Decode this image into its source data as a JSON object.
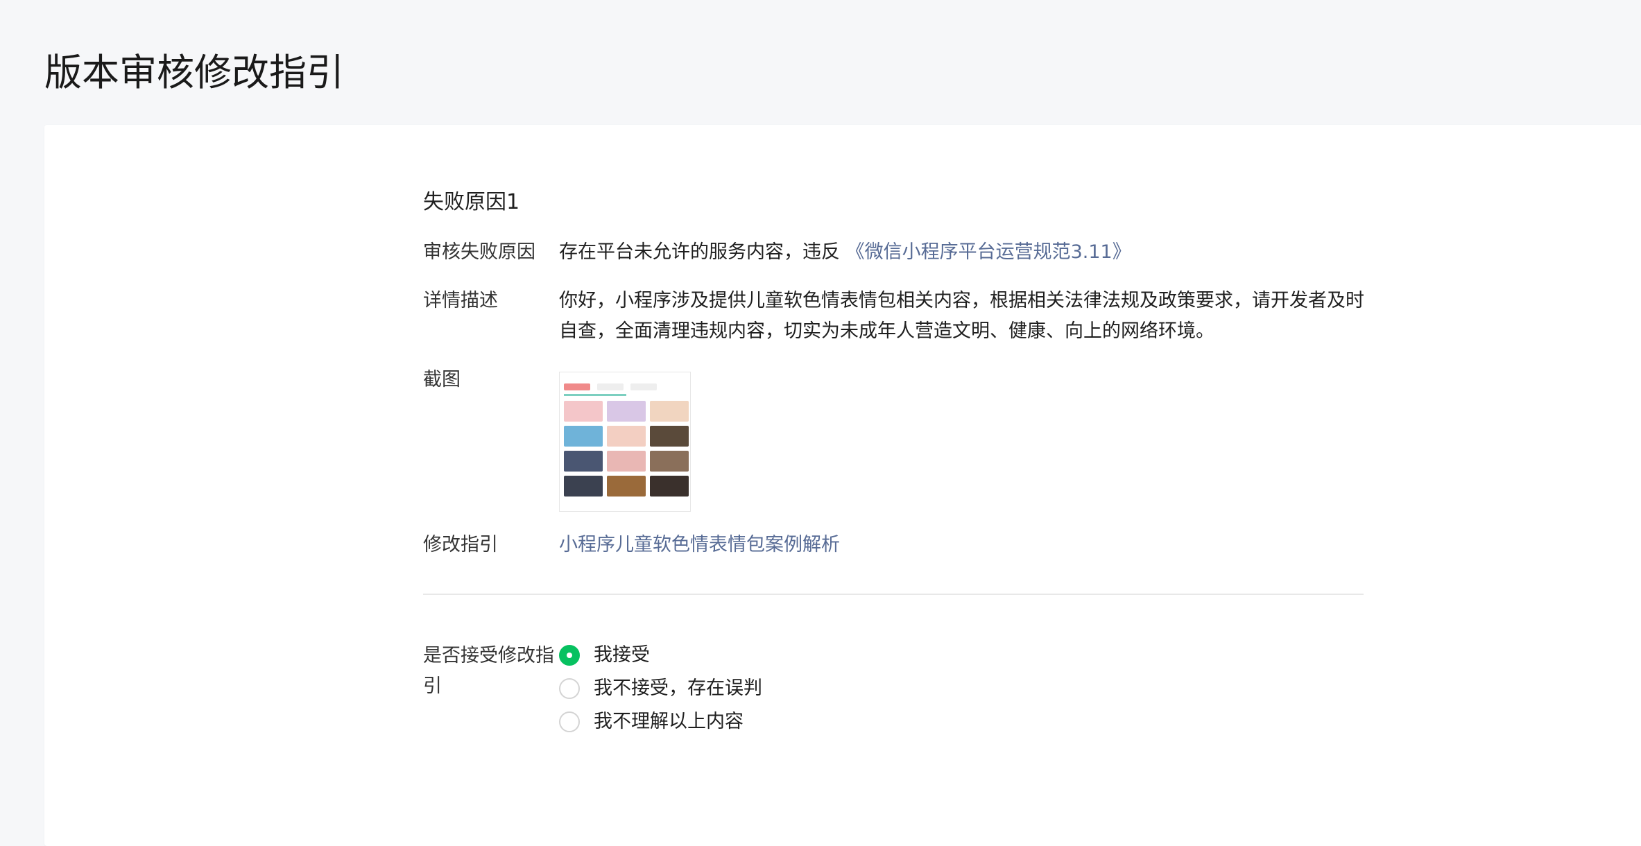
{
  "page": {
    "title": "版本审核修改指引"
  },
  "reason": {
    "section_title": "失败原因1",
    "fail_reason_label": "审核失败原因",
    "fail_reason_text": "存在平台未允许的服务内容，违反",
    "fail_reason_link": "《微信小程序平台运营规范3.11》",
    "detail_label": "详情描述",
    "detail_text": "你好，小程序涉及提供儿童软色情表情包相关内容，根据相关法律法规及政策要求，请开发者及时自查，全面清理违规内容，切实为未成年人营造文明、健康、向上的网络环境。",
    "screenshot_label": "截图",
    "guide_label": "修改指引",
    "guide_link": "小程序儿童软色情表情包案例解析"
  },
  "accept": {
    "label": "是否接受修改指引",
    "options": [
      {
        "label": "我接受",
        "checked": true
      },
      {
        "label": "我不接受，存在误判",
        "checked": false
      },
      {
        "label": "我不理解以上内容",
        "checked": false
      }
    ],
    "accent_color": "#07c160"
  },
  "colors": {
    "link": "#576b95",
    "background": "#f6f7f9",
    "card": "#ffffff"
  }
}
